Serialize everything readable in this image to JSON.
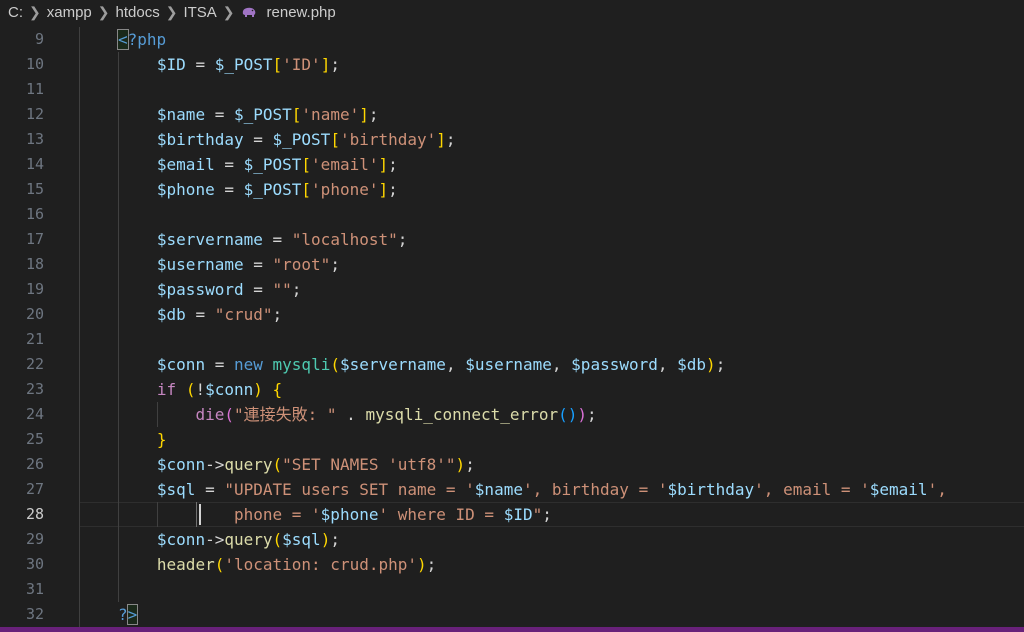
{
  "breadcrumb": {
    "items": [
      "C:",
      "xampp",
      "htdocs",
      "ITSA",
      "renew.php"
    ]
  },
  "editor": {
    "language": "php",
    "current_line": 28,
    "lines": [
      {
        "num": "9",
        "tokens": [
          [
            "<?php",
            "kw"
          ]
        ]
      },
      {
        "num": "10",
        "tokens": [
          [
            "$ID",
            "var"
          ],
          [
            " = ",
            "op"
          ],
          [
            "$_POST",
            "var"
          ],
          [
            "[",
            "b1"
          ],
          [
            "'ID'",
            "str"
          ],
          [
            "]",
            "b1"
          ],
          [
            ";",
            "op"
          ]
        ]
      },
      {
        "num": "11",
        "tokens": []
      },
      {
        "num": "12",
        "tokens": [
          [
            "$name",
            "var"
          ],
          [
            " = ",
            "op"
          ],
          [
            "$_POST",
            "var"
          ],
          [
            "[",
            "b1"
          ],
          [
            "'name'",
            "str"
          ],
          [
            "]",
            "b1"
          ],
          [
            ";",
            "op"
          ]
        ]
      },
      {
        "num": "13",
        "tokens": [
          [
            "$birthday",
            "var"
          ],
          [
            " = ",
            "op"
          ],
          [
            "$_POST",
            "var"
          ],
          [
            "[",
            "b1"
          ],
          [
            "'birthday'",
            "str"
          ],
          [
            "]",
            "b1"
          ],
          [
            ";",
            "op"
          ]
        ]
      },
      {
        "num": "14",
        "tokens": [
          [
            "$email",
            "var"
          ],
          [
            " = ",
            "op"
          ],
          [
            "$_POST",
            "var"
          ],
          [
            "[",
            "b1"
          ],
          [
            "'email'",
            "str"
          ],
          [
            "]",
            "b1"
          ],
          [
            ";",
            "op"
          ]
        ]
      },
      {
        "num": "15",
        "tokens": [
          [
            "$phone",
            "var"
          ],
          [
            " = ",
            "op"
          ],
          [
            "$_POST",
            "var"
          ],
          [
            "[",
            "b1"
          ],
          [
            "'phone'",
            "str"
          ],
          [
            "]",
            "b1"
          ],
          [
            ";",
            "op"
          ]
        ]
      },
      {
        "num": "16",
        "tokens": []
      },
      {
        "num": "17",
        "tokens": [
          [
            "$servername",
            "var"
          ],
          [
            " = ",
            "op"
          ],
          [
            "\"localhost\"",
            "str"
          ],
          [
            ";",
            "op"
          ]
        ]
      },
      {
        "num": "18",
        "tokens": [
          [
            "$username",
            "var"
          ],
          [
            " = ",
            "op"
          ],
          [
            "\"root\"",
            "str"
          ],
          [
            ";",
            "op"
          ]
        ]
      },
      {
        "num": "19",
        "tokens": [
          [
            "$password",
            "var"
          ],
          [
            " = ",
            "op"
          ],
          [
            "\"\"",
            "str"
          ],
          [
            ";",
            "op"
          ]
        ]
      },
      {
        "num": "20",
        "tokens": [
          [
            "$db",
            "var"
          ],
          [
            " = ",
            "op"
          ],
          [
            "\"crud\"",
            "str"
          ],
          [
            ";",
            "op"
          ]
        ]
      },
      {
        "num": "21",
        "tokens": []
      },
      {
        "num": "22",
        "tokens": [
          [
            "$conn",
            "var"
          ],
          [
            " = ",
            "op"
          ],
          [
            "new",
            "kw"
          ],
          [
            " ",
            "op"
          ],
          [
            "mysqli",
            "cls"
          ],
          [
            "(",
            "b1"
          ],
          [
            "$servername",
            "var"
          ],
          [
            ", ",
            "op"
          ],
          [
            "$username",
            "var"
          ],
          [
            ", ",
            "op"
          ],
          [
            "$password",
            "var"
          ],
          [
            ", ",
            "op"
          ],
          [
            "$db",
            "var"
          ],
          [
            ")",
            "b1"
          ],
          [
            ";",
            "op"
          ]
        ]
      },
      {
        "num": "23",
        "tokens": [
          [
            "if",
            "ctl"
          ],
          [
            " ",
            "op"
          ],
          [
            "(",
            "b1"
          ],
          [
            "!",
            "op"
          ],
          [
            "$conn",
            "var"
          ],
          [
            ")",
            "b1"
          ],
          [
            " ",
            "op"
          ],
          [
            "{",
            "b1"
          ]
        ]
      },
      {
        "num": "24",
        "tokens": [
          [
            "    ",
            "op"
          ],
          [
            "die",
            "ctl"
          ],
          [
            "(",
            "b2"
          ],
          [
            "\"連接失敗: \"",
            "str"
          ],
          [
            " . ",
            "op"
          ],
          [
            "mysqli_connect_error",
            "fn"
          ],
          [
            "()",
            "b3"
          ],
          [
            ")",
            "b2"
          ],
          [
            ";",
            "op"
          ]
        ]
      },
      {
        "num": "25",
        "tokens": [
          [
            "}",
            "b1"
          ]
        ]
      },
      {
        "num": "26",
        "tokens": [
          [
            "$conn",
            "var"
          ],
          [
            "->",
            "op"
          ],
          [
            "query",
            "fn"
          ],
          [
            "(",
            "b1"
          ],
          [
            "\"SET NAMES 'utf8'\"",
            "str"
          ],
          [
            ")",
            "b1"
          ],
          [
            ";",
            "op"
          ]
        ]
      },
      {
        "num": "27",
        "tokens": [
          [
            "$sql",
            "var"
          ],
          [
            " = ",
            "op"
          ],
          [
            "\"UPDATE users SET name = '",
            "str"
          ],
          [
            "$name",
            "var"
          ],
          [
            "', birthday = '",
            "str"
          ],
          [
            "$birthday",
            "var"
          ],
          [
            "', email = '",
            "str"
          ],
          [
            "$email",
            "var"
          ],
          [
            "',",
            "str"
          ]
        ]
      },
      {
        "num": "28",
        "tokens": [
          [
            "        ",
            "op"
          ],
          [
            "phone = '",
            "str"
          ],
          [
            "$phone",
            "var"
          ],
          [
            "' where ID = ",
            "str"
          ],
          [
            "$ID",
            "var"
          ],
          [
            "\"",
            "str"
          ],
          [
            ";",
            "op"
          ]
        ]
      },
      {
        "num": "29",
        "tokens": [
          [
            "$conn",
            "var"
          ],
          [
            "->",
            "op"
          ],
          [
            "query",
            "fn"
          ],
          [
            "(",
            "b1"
          ],
          [
            "$sql",
            "var"
          ],
          [
            ")",
            "b1"
          ],
          [
            ";",
            "op"
          ]
        ]
      },
      {
        "num": "30",
        "tokens": [
          [
            "header",
            "fn"
          ],
          [
            "(",
            "b1"
          ],
          [
            "'location: crud.php'",
            "str"
          ],
          [
            ")",
            "b1"
          ],
          [
            ";",
            "op"
          ]
        ]
      },
      {
        "num": "31",
        "tokens": []
      },
      {
        "num": "32",
        "tokens": [
          [
            "?>",
            "kw"
          ]
        ]
      }
    ]
  },
  "colors": {
    "background": "#1f1f1f",
    "line_number": "#6e7681",
    "variable": "#9cdcfe",
    "string": "#ce9178",
    "function": "#dcdcaa",
    "keyword": "#569cd6",
    "control": "#c586c0",
    "class": "#4ec9b0",
    "bracket_level1": "#ffd700",
    "bracket_level2": "#da70d6",
    "bracket_level3": "#179fff",
    "status_bar": "#68217a"
  },
  "icons": {
    "breadcrumb_separator": "chevron-right-icon",
    "file_type": "php-elephant-icon"
  }
}
